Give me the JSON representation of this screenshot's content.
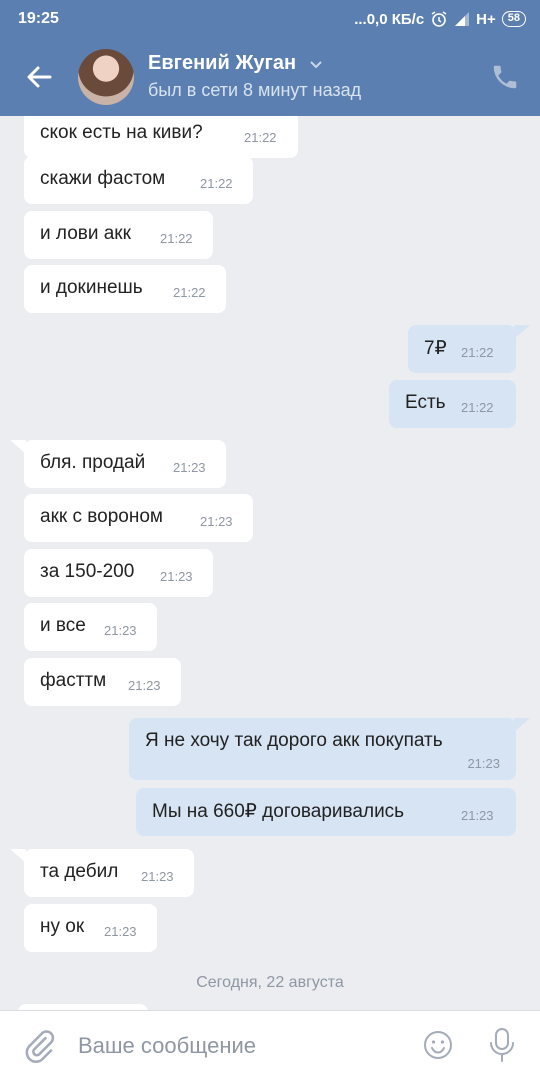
{
  "status_bar": {
    "time": "19:25",
    "network_speed": "...0,0 КБ/с",
    "network_type": "H+",
    "battery": "58"
  },
  "header": {
    "contact_name": "Евгений Жуган",
    "last_seen": "был в сети 8 минут назад"
  },
  "messages": [
    {
      "side": "in",
      "text": "скок есть на киви?",
      "time": "21:22"
    },
    {
      "side": "in",
      "text": "скажи фастом",
      "time": "21:22"
    },
    {
      "side": "in",
      "text": "и лови акк",
      "time": "21:22"
    },
    {
      "side": "in",
      "text": "и докинешь",
      "time": "21:22"
    },
    {
      "side": "out",
      "text": "7₽",
      "time": "21:22"
    },
    {
      "side": "out",
      "text": "Есть",
      "time": "21:22"
    },
    {
      "side": "in",
      "text": "бля. продай",
      "time": "21:23"
    },
    {
      "side": "in",
      "text": "акк с вороном",
      "time": "21:23"
    },
    {
      "side": "in",
      "text": "за 150-200",
      "time": "21:23"
    },
    {
      "side": "in",
      "text": "и все",
      "time": "21:23"
    },
    {
      "side": "in",
      "text": "фасттм",
      "time": "21:23"
    },
    {
      "side": "out",
      "text": "Я не хочу так дорого акк покупать",
      "time": "21:23"
    },
    {
      "side": "out",
      "text": "Мы на 660₽ договаривались",
      "time": "21:23"
    },
    {
      "side": "in",
      "text": "та дебил",
      "time": "21:23"
    },
    {
      "side": "in",
      "text": "ну ок",
      "time": "21:23"
    }
  ],
  "date_separator": "Сегодня, 22 августа",
  "composer": {
    "placeholder": "Ваше сообщение"
  },
  "icons": [
    "back-arrow-icon",
    "chevron-down-icon",
    "phone-icon",
    "paperclip-icon",
    "smiley-icon",
    "microphone-icon",
    "alarm-icon",
    "signal-icon",
    "battery-icon"
  ],
  "colors": {
    "header": "#5b7fb0",
    "chat_background": "#ebedf0",
    "incoming_bubble": "#ffffff",
    "outgoing_bubble": "#d7e4f3",
    "timestamp": "#8e97a3"
  }
}
